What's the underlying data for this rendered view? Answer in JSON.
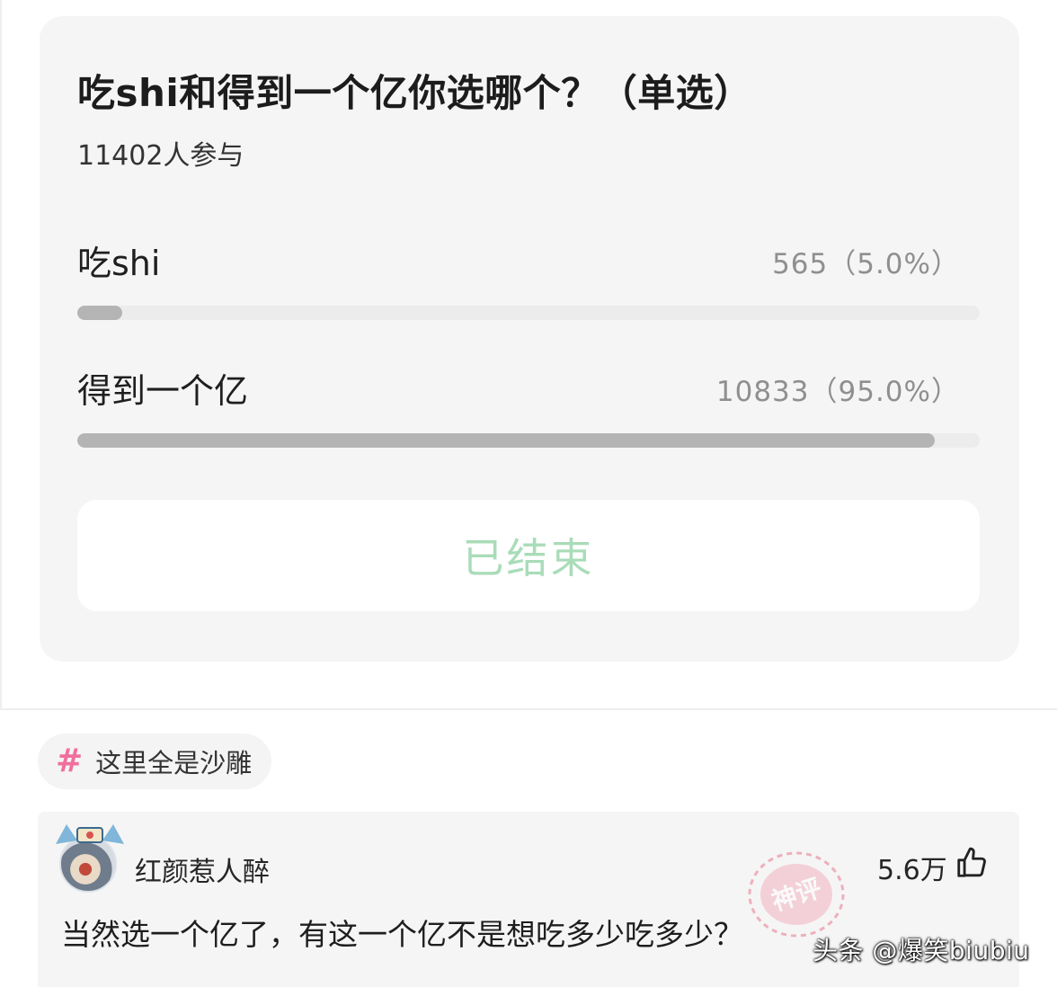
{
  "poll": {
    "title": "吃shi和得到一个亿你选哪个？（单选）",
    "participants": "11402人参与",
    "options": [
      {
        "label": "吃shi",
        "stat": "565（5.0%）",
        "percent": 5.0
      },
      {
        "label": "得到一个亿",
        "stat": "10833（95.0%）",
        "percent": 95.0
      }
    ],
    "status_button": "已结束"
  },
  "topic": {
    "icon": "hash-icon",
    "label": "这里全是沙雕"
  },
  "comment": {
    "username": "红颜惹人醉",
    "likes": "5.6万",
    "text": "当然选一个亿了，有这一个亿不是想吃多少吃多少？",
    "badge": "神评",
    "badge_icon": "stamp-icon"
  },
  "watermark": "头条 @爆笑biubiu",
  "colors": {
    "card_bg": "#f5f5f5",
    "bar_fill": "#b4b4b4",
    "bar_track": "#ececec",
    "ended_text": "#a9dcb8",
    "hash_accent": "#f06f9c",
    "stamp": "#e8798f"
  }
}
